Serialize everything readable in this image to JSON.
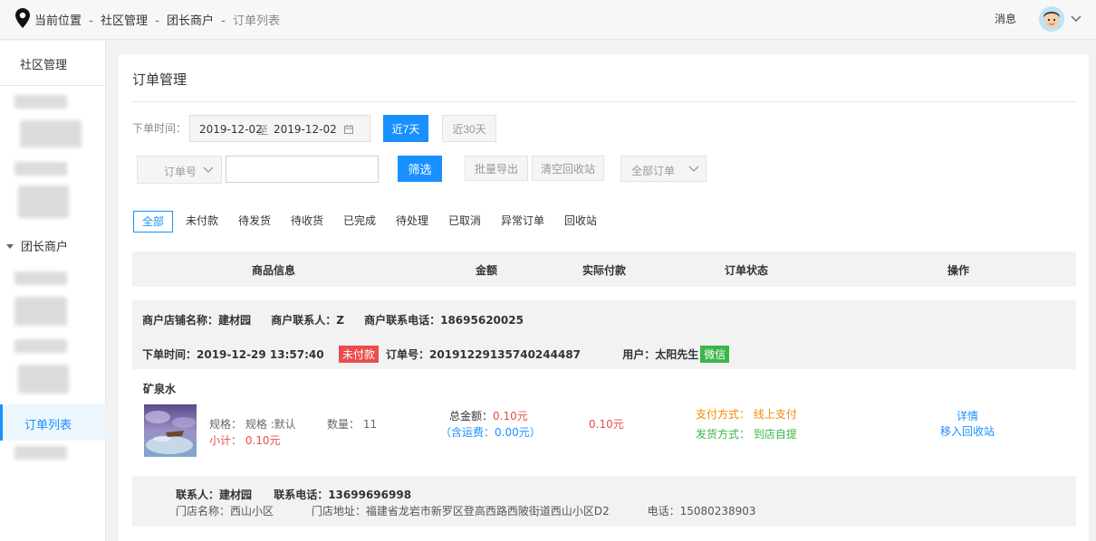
{
  "breadcrumb": {
    "label": "当前位置",
    "items": [
      "社区管理",
      "团长商户"
    ],
    "current": "订单列表"
  },
  "header": {
    "message": "消息"
  },
  "sidebar": {
    "title": "社区管理",
    "group": "团长商户",
    "active_item": "订单列表"
  },
  "page": {
    "title": "订单管理"
  },
  "filters": {
    "time_label": "下单时间：",
    "date_start": "2019-12-02",
    "date_sep": "至",
    "date_end": "2019-12-02",
    "btn_7days": "近7天",
    "btn_30days": "近30天",
    "order_field": "订单号",
    "search_value": "",
    "btn_filter": "筛选",
    "btn_export": "批量导出",
    "btn_clear": "清空回收站",
    "order_type": "全部订单"
  },
  "tabs": [
    "全部",
    "未付款",
    "待发货",
    "待收货",
    "已完成",
    "待处理",
    "已取消",
    "异常订单",
    "回收站"
  ],
  "table_header": [
    "商品信息",
    "金额",
    "实际付款",
    "订单状态",
    "操作"
  ],
  "order": {
    "shop_name": "商户店铺名称：建材园",
    "shop_contact": "商户联系人：Z",
    "shop_phone": "商户联系电话：18695620025",
    "order_time": "下单时间：2019-12-29 13:57:40",
    "status_badge": "未付款",
    "order_no": "订单号：20191229135740244487",
    "user": "用户：太阳先生",
    "user_badge": "微信",
    "product_name": "矿泉水",
    "spec": "规格：  规格 :默认",
    "quantity": "数量：  11",
    "subtotal": "小计：  0.10元",
    "total_label": "总金额：",
    "total_value": "0.10元",
    "freight": "（含运费：0.00元）",
    "paid": "0.10元",
    "pay_method": "支付方式：  线上支付",
    "ship_method": "发货方式：  到店自提",
    "op_detail": "详情",
    "op_recycle": "移入回收站"
  },
  "contact": {
    "person": "联系人：建材园",
    "phone": "联系电话：13699696998",
    "store_name": "门店名称：西山小区",
    "store_addr": "门店地址：福建省龙岩市新罗区登高西路西陂街道西山小区D2",
    "store_phone": "电话：15080238903"
  },
  "colors": {
    "accent": "#1890ff",
    "danger": "#e94d4d",
    "success": "#3ab54a",
    "warning": "#f08c00"
  }
}
